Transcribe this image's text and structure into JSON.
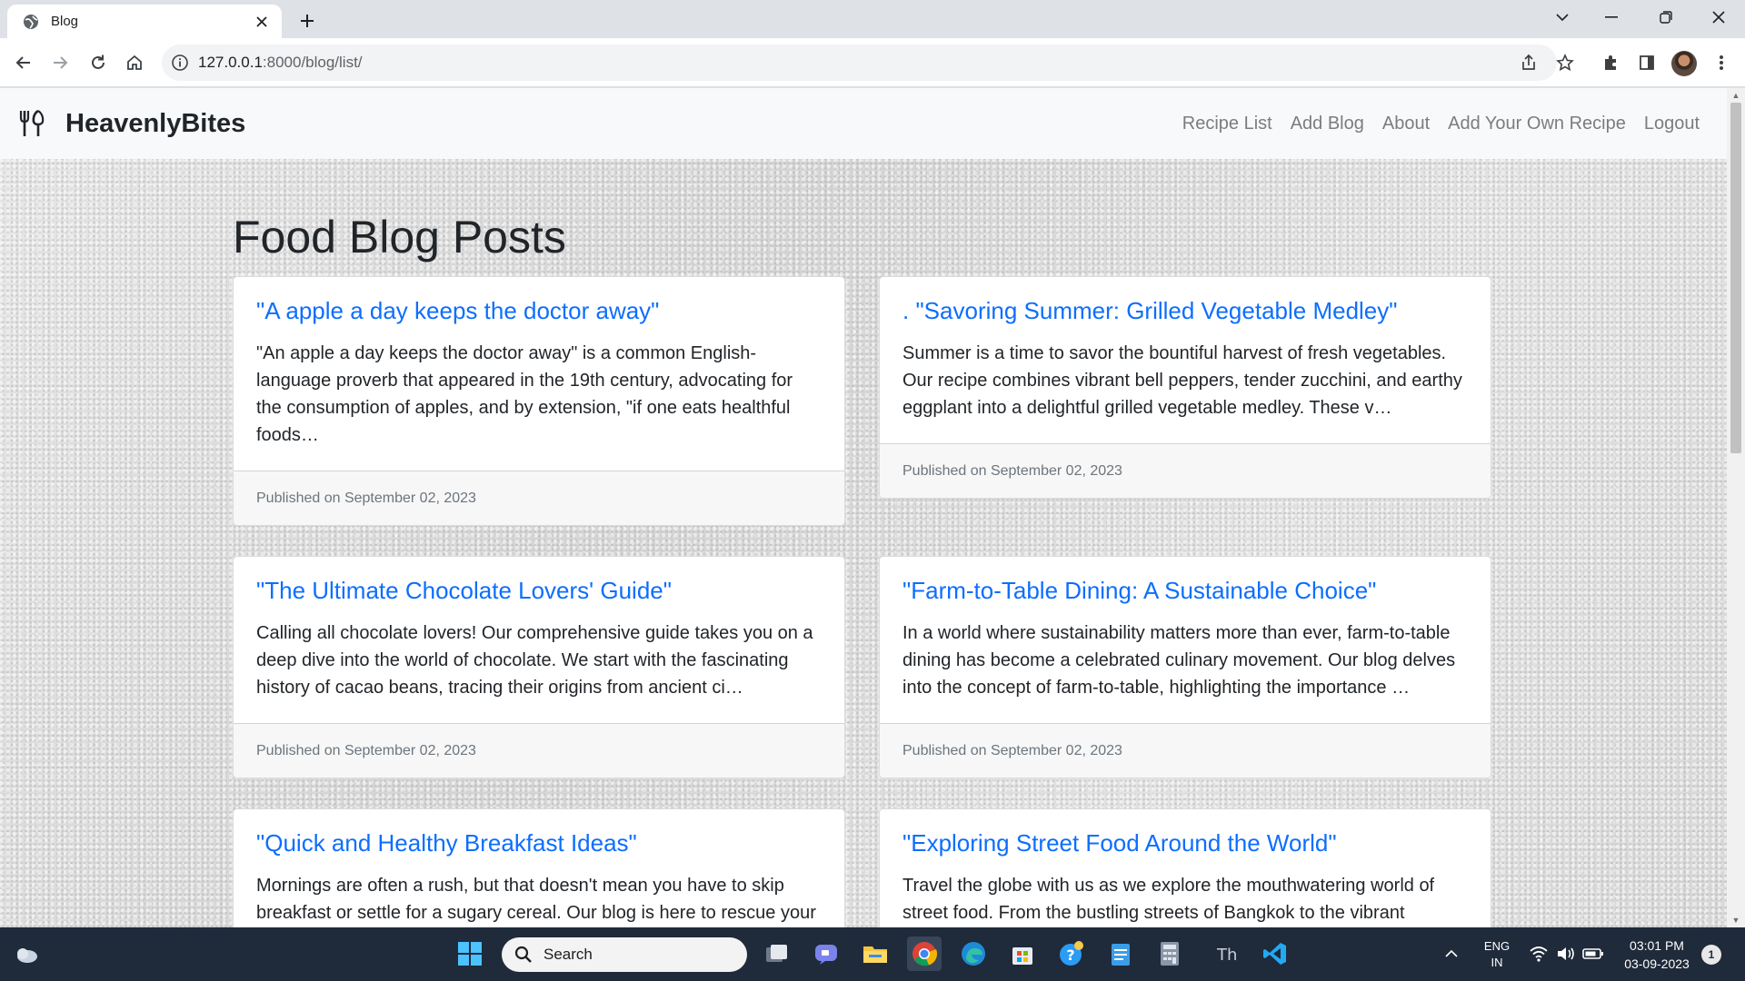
{
  "browser": {
    "tab_title": "Blog",
    "url_host": "127.0.0.1",
    "url_path": ":8000/blog/list/"
  },
  "site": {
    "brand": "HeavenlyBites",
    "nav": [
      "Recipe List",
      "Add Blog",
      "About",
      "Add Your Own Recipe",
      "Logout"
    ]
  },
  "page": {
    "heading": "Food Blog Posts"
  },
  "posts": [
    {
      "title": "\"A apple a day keeps the doctor away\"",
      "excerpt": "\"An apple a day keeps the doctor away\" is a common English-language proverb that appeared in the 19th century, advocating for the consumption of apples, and by extension, \"if one eats healthful foods…",
      "date": "Published on September 02, 2023"
    },
    {
      "title": ". \"Savoring Summer: Grilled Vegetable Medley\"",
      "excerpt": "Summer is a time to savor the bountiful harvest of fresh vegetables. Our recipe combines vibrant bell peppers, tender zucchini, and earthy eggplant into a delightful grilled vegetable medley. These v…",
      "date": "Published on September 02, 2023"
    },
    {
      "title": "\"The Ultimate Chocolate Lovers' Guide\"",
      "excerpt": "Calling all chocolate lovers! Our comprehensive guide takes you on a deep dive into the world of chocolate. We start with the fascinating history of cacao beans, tracing their origins from ancient ci…",
      "date": "Published on September 02, 2023"
    },
    {
      "title": "\"Farm-to-Table Dining: A Sustainable Choice\"",
      "excerpt": "In a world where sustainability matters more than ever, farm-to-table dining has become a celebrated culinary movement. Our blog delves into the concept of farm-to-table, highlighting the importance …",
      "date": "Published on September 02, 2023"
    },
    {
      "title": "\"Quick and Healthy Breakfast Ideas\"",
      "excerpt": "Mornings are often a rush, but that doesn't mean you have to skip breakfast or settle for a sugary cereal. Our blog is here to rescue your",
      "date": ""
    },
    {
      "title": "\"Exploring Street Food Around the World\"",
      "excerpt": "Travel the globe with us as we explore the mouthwatering world of street food. From the bustling streets of Bangkok to the vibrant",
      "date": ""
    }
  ],
  "taskbar": {
    "search_label": "Search",
    "lang_line1": "ENG",
    "lang_line2": "IN",
    "time": "03:01 PM",
    "date": "03-09-2023",
    "notification_count": "1"
  },
  "colors": {
    "link": "#0d6efd",
    "navbar_bg": "#f8f9fa",
    "taskbar_bg": "#1f2a3a"
  },
  "icons": [
    "globe-icon",
    "close-icon",
    "plus-icon",
    "back-icon",
    "forward-icon",
    "reload-icon",
    "home-icon",
    "info-icon",
    "share-icon",
    "star-icon",
    "extensions-icon",
    "sidepanel-icon",
    "kebab-icon",
    "utensils-icon",
    "windows-start-icon",
    "search-icon"
  ]
}
